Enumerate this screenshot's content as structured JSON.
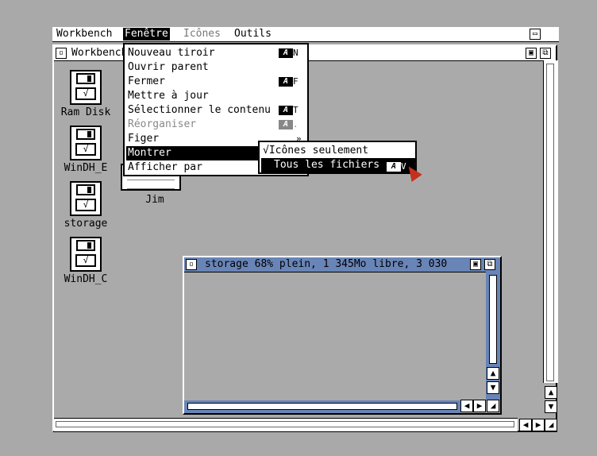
{
  "menubar": {
    "items": [
      "Workbench",
      "Fenêtre",
      "Icônes",
      "Outils"
    ]
  },
  "wb_window": {
    "title": "Workbench"
  },
  "icons": [
    {
      "name": "Ram Disk",
      "label": "√"
    },
    {
      "name": "WinDH_E",
      "label": "√"
    },
    {
      "name": "storage",
      "label": "√"
    },
    {
      "name": "WinDH_C",
      "label": "√"
    }
  ],
  "drawer": {
    "name": "Jim"
  },
  "fenetre_menu": {
    "items": [
      {
        "label": "Nouveau tiroir",
        "key": "N"
      },
      {
        "label": "Ouvrir parent",
        "key": ""
      },
      {
        "label": "Fermer",
        "key": "F"
      },
      {
        "label": "Mettre à jour",
        "key": ""
      },
      {
        "label": "Sélectionner le contenu",
        "key": "T"
      },
      {
        "label": "Réorganiser",
        "key": "."
      },
      {
        "label": "Figer",
        "key": "»"
      },
      {
        "label": "Montrer",
        "key": ""
      },
      {
        "label": "Afficher par",
        "key": ""
      }
    ]
  },
  "montrer_submenu": {
    "items": [
      {
        "label": "Icônes seulement",
        "check": "√"
      },
      {
        "label": "Tous les fichiers",
        "key": "V"
      }
    ]
  },
  "storage_window": {
    "title": "storage  68% plein, 1 345Mo libre, 3 030"
  },
  "colors": {
    "accent": "#6985b8",
    "background": "#aaaaaa",
    "cursor": "#c43020"
  }
}
